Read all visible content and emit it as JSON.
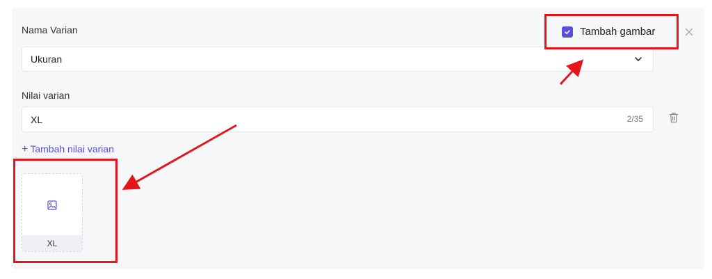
{
  "variant_name": {
    "label": "Nama Varian",
    "value": "Ukuran"
  },
  "add_image": {
    "label": "Tambah gambar",
    "checked": true
  },
  "variant_value": {
    "label": "Nilai varian",
    "value": "XL",
    "counter": "2/35"
  },
  "add_value_link": {
    "plus": "+",
    "label": "Tambah nilai varian"
  },
  "thumbnail": {
    "label": "XL"
  },
  "colors": {
    "accent": "#5b4fd8",
    "annotation": "#e6141b"
  },
  "icons": [
    "chevron-down-icon",
    "check-icon",
    "close-icon",
    "trash-icon",
    "image-icon",
    "annotation-arrow"
  ]
}
